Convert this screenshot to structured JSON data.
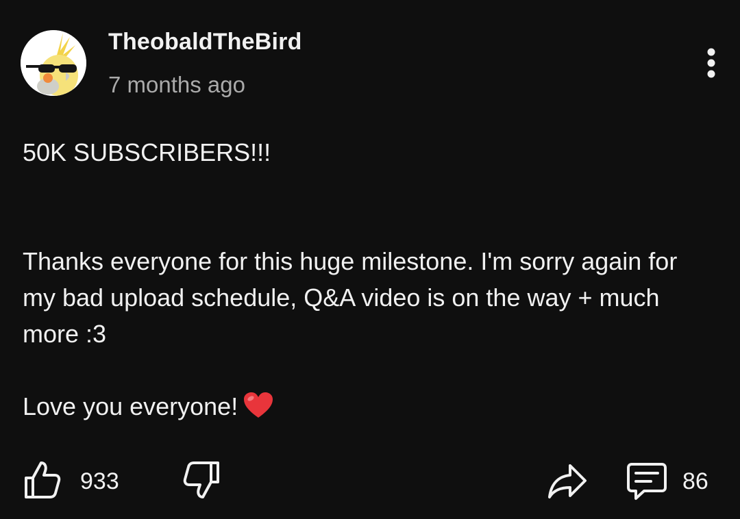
{
  "post": {
    "author": "TheobaldTheBird",
    "time": "7 months ago",
    "headline": "50K SUBSCRIBERS!!!",
    "paragraph": "Thanks everyone for this huge milestone. I'm sorry again for my bad upload schedule, Q&A video is on the way + much more :3",
    "closing": "Love you everyone!",
    "closing_emoji_icon": "red-heart-emoji"
  },
  "actions": {
    "like_icon": "thumbs-up-icon",
    "like_count": "933",
    "dislike_icon": "thumbs-down-icon",
    "share_icon": "share-arrow-icon",
    "comments_icon": "comment-bubble-icon",
    "comment_count": "86",
    "menu_icon": "more-vertical-icon"
  },
  "colors": {
    "background": "#0f0f0f",
    "primary_text": "#f1f1f1",
    "secondary_text": "#aaaaaa",
    "heart": "#e8353b"
  }
}
